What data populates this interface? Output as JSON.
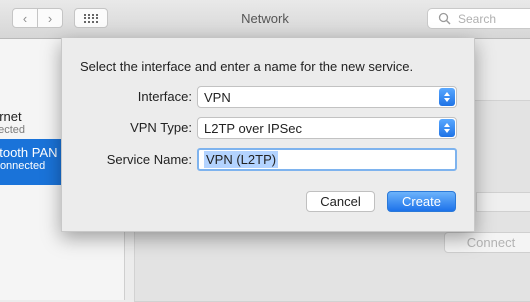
{
  "window": {
    "title": "Network"
  },
  "toolbar": {
    "back_glyph": "‹",
    "forward_glyph": "›",
    "grid_icon": "grid-icon",
    "search_placeholder": "Search"
  },
  "sidebar": {
    "items": [
      {
        "name": "ernet",
        "status": "nected"
      },
      {
        "name": "etooth PAN",
        "status": "Connected",
        "selected": true
      }
    ]
  },
  "background": {
    "connect_label": "Connect"
  },
  "dialog": {
    "prompt": "Select the interface and enter a name for the new service.",
    "interface_label": "Interface:",
    "interface_value": "VPN",
    "vpn_type_label": "VPN Type:",
    "vpn_type_value": "L2TP over IPSec",
    "service_name_label": "Service Name:",
    "service_name_value": "VPN (L2TP)",
    "cancel_label": "Cancel",
    "create_label": "Create"
  },
  "colors": {
    "accent": "#1d72ea",
    "selection": "#1a73d9"
  }
}
